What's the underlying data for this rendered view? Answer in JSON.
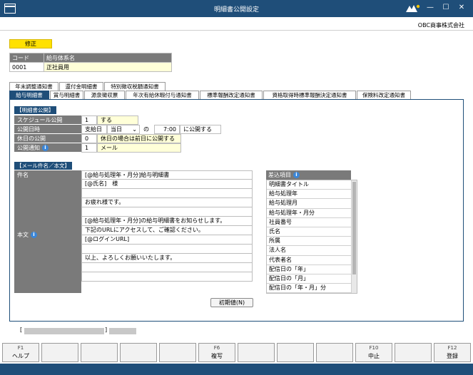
{
  "window": {
    "title": "明細書公開設定",
    "controls": {
      "minimize": "—",
      "maximize": "☐",
      "close": "✕"
    },
    "logo_icon": "obc-logo-icon"
  },
  "company": "OBC商事株式会社",
  "mode_badge": "修正",
  "kind_table": {
    "headers": [
      "コード",
      "給与体系名"
    ],
    "row": [
      "0001",
      "正社員用"
    ]
  },
  "tabs_row1": [
    "年末調整通知書",
    "還付金明細書",
    "特別徴収税額通知書"
  ],
  "tabs_row2": [
    "給与明細書",
    "賞与明細書",
    "源泉徴収票",
    "年次有給休暇付与通知書",
    "標準報酬改定通知書",
    "資格取得時標準報酬決定通知書",
    "保険料改定通知書"
  ],
  "publish": {
    "section_title": "【明細書公開】",
    "schedule": {
      "label": "スケジュール公開",
      "code": "1",
      "value": "する"
    },
    "date": {
      "label": "公開日時",
      "base": "支給日",
      "day_select": "当日",
      "separator": "の",
      "time": "7:00",
      "suffix": "に公開する"
    },
    "holiday": {
      "label": "休日の公開",
      "code": "0",
      "value": "休日の場合は前日に公開する"
    },
    "notify": {
      "label": "公開通知",
      "code": "1",
      "value": "メール"
    }
  },
  "mail": {
    "section_title": "【メール件名／本文】",
    "subject_label": "件名",
    "subject": "[@給与処理年・月分]給与明細書",
    "body_label": "本文",
    "body_lines": [
      "[@氏名]　様",
      "",
      "お疲れ様です。",
      "",
      "[@給与処理年・月分]の給与明細書をお知らせします。",
      "下記のURLにアクセスして、ご確認ください。",
      "[@ログインURL]",
      "",
      "以上、よろしくお願いいたします。",
      "",
      ""
    ]
  },
  "insert_items": {
    "header": "差込項目",
    "items": [
      "明細書タイトル",
      "給与処理年",
      "給与処理月",
      "給与処理年・月分",
      "社員番号",
      "氏名",
      "所属",
      "法人名",
      "代表者名",
      "配信日の「年」",
      "配信日の「月」",
      "配信日の「年・月」分"
    ]
  },
  "reset_button": "初期値(N)",
  "status": {
    "open": "[",
    "close": "]"
  },
  "fkeys": [
    {
      "key": "F1",
      "label": "ヘルプ"
    },
    {
      "key": "",
      "label": ""
    },
    {
      "key": "",
      "label": ""
    },
    {
      "key": "",
      "label": ""
    },
    {
      "key": "",
      "label": ""
    },
    {
      "key": "F6",
      "label": "複写"
    },
    {
      "key": "",
      "label": ""
    },
    {
      "key": "",
      "label": ""
    },
    {
      "key": "",
      "label": ""
    },
    {
      "key": "F10",
      "label": "中止"
    },
    {
      "key": "",
      "label": ""
    },
    {
      "key": "F12",
      "label": "登録"
    }
  ]
}
